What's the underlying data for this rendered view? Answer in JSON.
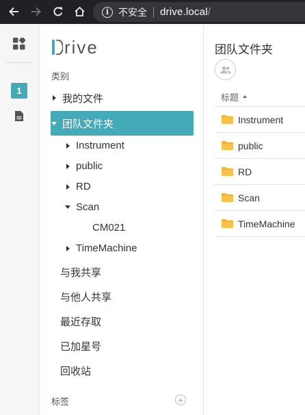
{
  "browser": {
    "security_label": "不安全",
    "url_host": "drive.local",
    "url_path": "/"
  },
  "rail": {
    "badge": "1"
  },
  "sidebar": {
    "logo_rest": "rive",
    "category_label": "类别",
    "my_files": "我的文件",
    "team_folder": "团队文件夹",
    "team_children": [
      {
        "label": "Instrument",
        "expanded": false
      },
      {
        "label": "public",
        "expanded": false
      },
      {
        "label": "RD",
        "expanded": false
      },
      {
        "label": "Scan",
        "expanded": true
      },
      {
        "label": "CM021",
        "expanded": null
      },
      {
        "label": "TimeMachine",
        "expanded": false
      }
    ],
    "shared_with_me": "与我共享",
    "shared_with_others": "与他人共享",
    "recent": "最近存取",
    "starred": "已加星号",
    "recycle_bin": "回收站",
    "tags_label": "标签",
    "add_tag_icon": "plus-circle-icon"
  },
  "main": {
    "title": "团队文件夹",
    "column_title": "标题",
    "rows": [
      "Instrument",
      "public",
      "RD",
      "Scan",
      "TimeMachine"
    ]
  },
  "colors": {
    "accent": "#45aab8",
    "folder": "#f5b233",
    "chrome": "#202124"
  }
}
